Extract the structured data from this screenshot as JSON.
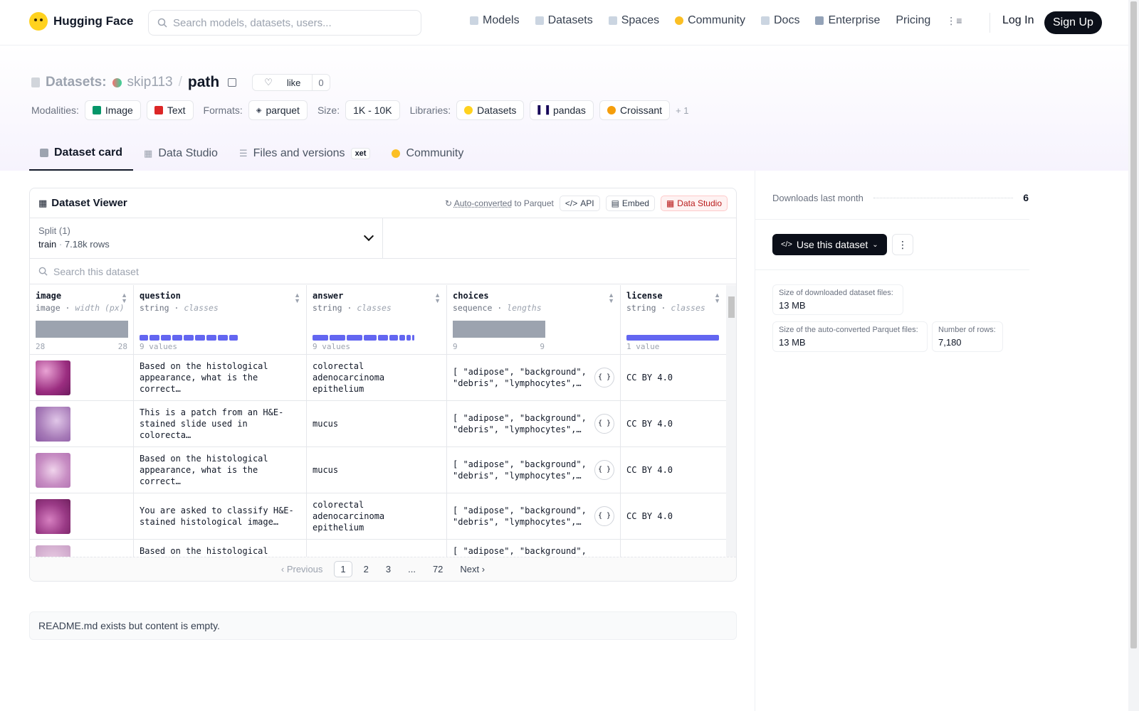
{
  "nav": {
    "brand": "Hugging Face",
    "search_placeholder": "Search models, datasets, users...",
    "links": [
      "Models",
      "Datasets",
      "Spaces",
      "Community",
      "Docs",
      "Enterprise",
      "Pricing"
    ],
    "login": "Log In",
    "signup": "Sign Up"
  },
  "header": {
    "section": "Datasets:",
    "user": "skip113",
    "repo": "path",
    "like_label": "like",
    "like_count": "0",
    "modalities_label": "Modalities:",
    "modalities": [
      "Image",
      "Text"
    ],
    "formats_label": "Formats:",
    "format": "parquet",
    "size_label": "Size:",
    "size": "1K - 10K",
    "libraries_label": "Libraries:",
    "libraries": [
      "Datasets",
      "pandas",
      "Croissant"
    ],
    "more": "+ 1"
  },
  "tabs": [
    "Dataset card",
    "Data Studio",
    "Files and versions",
    "Community"
  ],
  "tab_badge": "xet",
  "viewer": {
    "title": "Dataset Viewer",
    "auto_converted": "Auto-converted",
    "to_parquet": "to Parquet",
    "api": "API",
    "embed": "Embed",
    "data_studio": "Data Studio",
    "split_label": "Split (1)",
    "split_name": "train",
    "split_rows": "7.18k rows",
    "search_placeholder": "Search this dataset",
    "columns": [
      {
        "name": "image",
        "type": "image",
        "hint": "width (px)",
        "foot_left": "28",
        "foot_right": "28"
      },
      {
        "name": "question",
        "type": "string",
        "hint": "classes",
        "foot_left": "9 values",
        "foot_right": ""
      },
      {
        "name": "answer",
        "type": "string",
        "hint": "classes",
        "foot_left": "9 values",
        "foot_right": ""
      },
      {
        "name": "choices",
        "type": "sequence",
        "hint": "lengths",
        "foot_left": "9",
        "foot_right": "9"
      },
      {
        "name": "license",
        "type": "string",
        "hint": "classes",
        "foot_left": "1 value",
        "foot_right": ""
      }
    ],
    "rows": [
      {
        "question": "Based on the histological appearance, what is the correct…",
        "answer": "colorectal adenocarcinoma epithelium",
        "choices": "[ \"adipose\", \"background\", \"debris\", \"lymphocytes\",…",
        "license": "CC BY 4.0"
      },
      {
        "question": "This is a patch from an H&E-stained slide used in colorecta…",
        "answer": "mucus",
        "choices": "[ \"adipose\", \"background\", \"debris\", \"lymphocytes\",…",
        "license": "CC BY 4.0"
      },
      {
        "question": "Based on the histological appearance, what is the correct…",
        "answer": "mucus",
        "choices": "[ \"adipose\", \"background\", \"debris\", \"lymphocytes\",…",
        "license": "CC BY 4.0"
      },
      {
        "question": "You are asked to classify H&E-stained histological image…",
        "answer": "colorectal adenocarcinoma epithelium",
        "choices": "[ \"adipose\", \"background\", \"debris\", \"lymphocytes\",…",
        "license": "CC BY 4.0"
      },
      {
        "question": "Based on the histological",
        "answer": "",
        "choices": "[ \"adipose\", \"background\",",
        "license": ""
      }
    ],
    "pager": {
      "prev": "Previous",
      "pages": [
        "1",
        "2",
        "3",
        "...",
        "72"
      ],
      "next": "Next"
    }
  },
  "readme": "README.md exists but content is empty.",
  "aside": {
    "downloads_label": "Downloads last month",
    "downloads": "6",
    "use_button": "Use this dataset",
    "stats": [
      {
        "label": "Size of downloaded dataset files:",
        "value": "13 MB"
      },
      {
        "label": "Size of the auto-converted Parquet files:",
        "value": "13 MB"
      },
      {
        "label": "Number of rows:",
        "value": "7,180"
      }
    ]
  },
  "colors": {
    "accent": "#6366f1",
    "dark": "#0b0f19",
    "brand": "#ffd21e"
  }
}
